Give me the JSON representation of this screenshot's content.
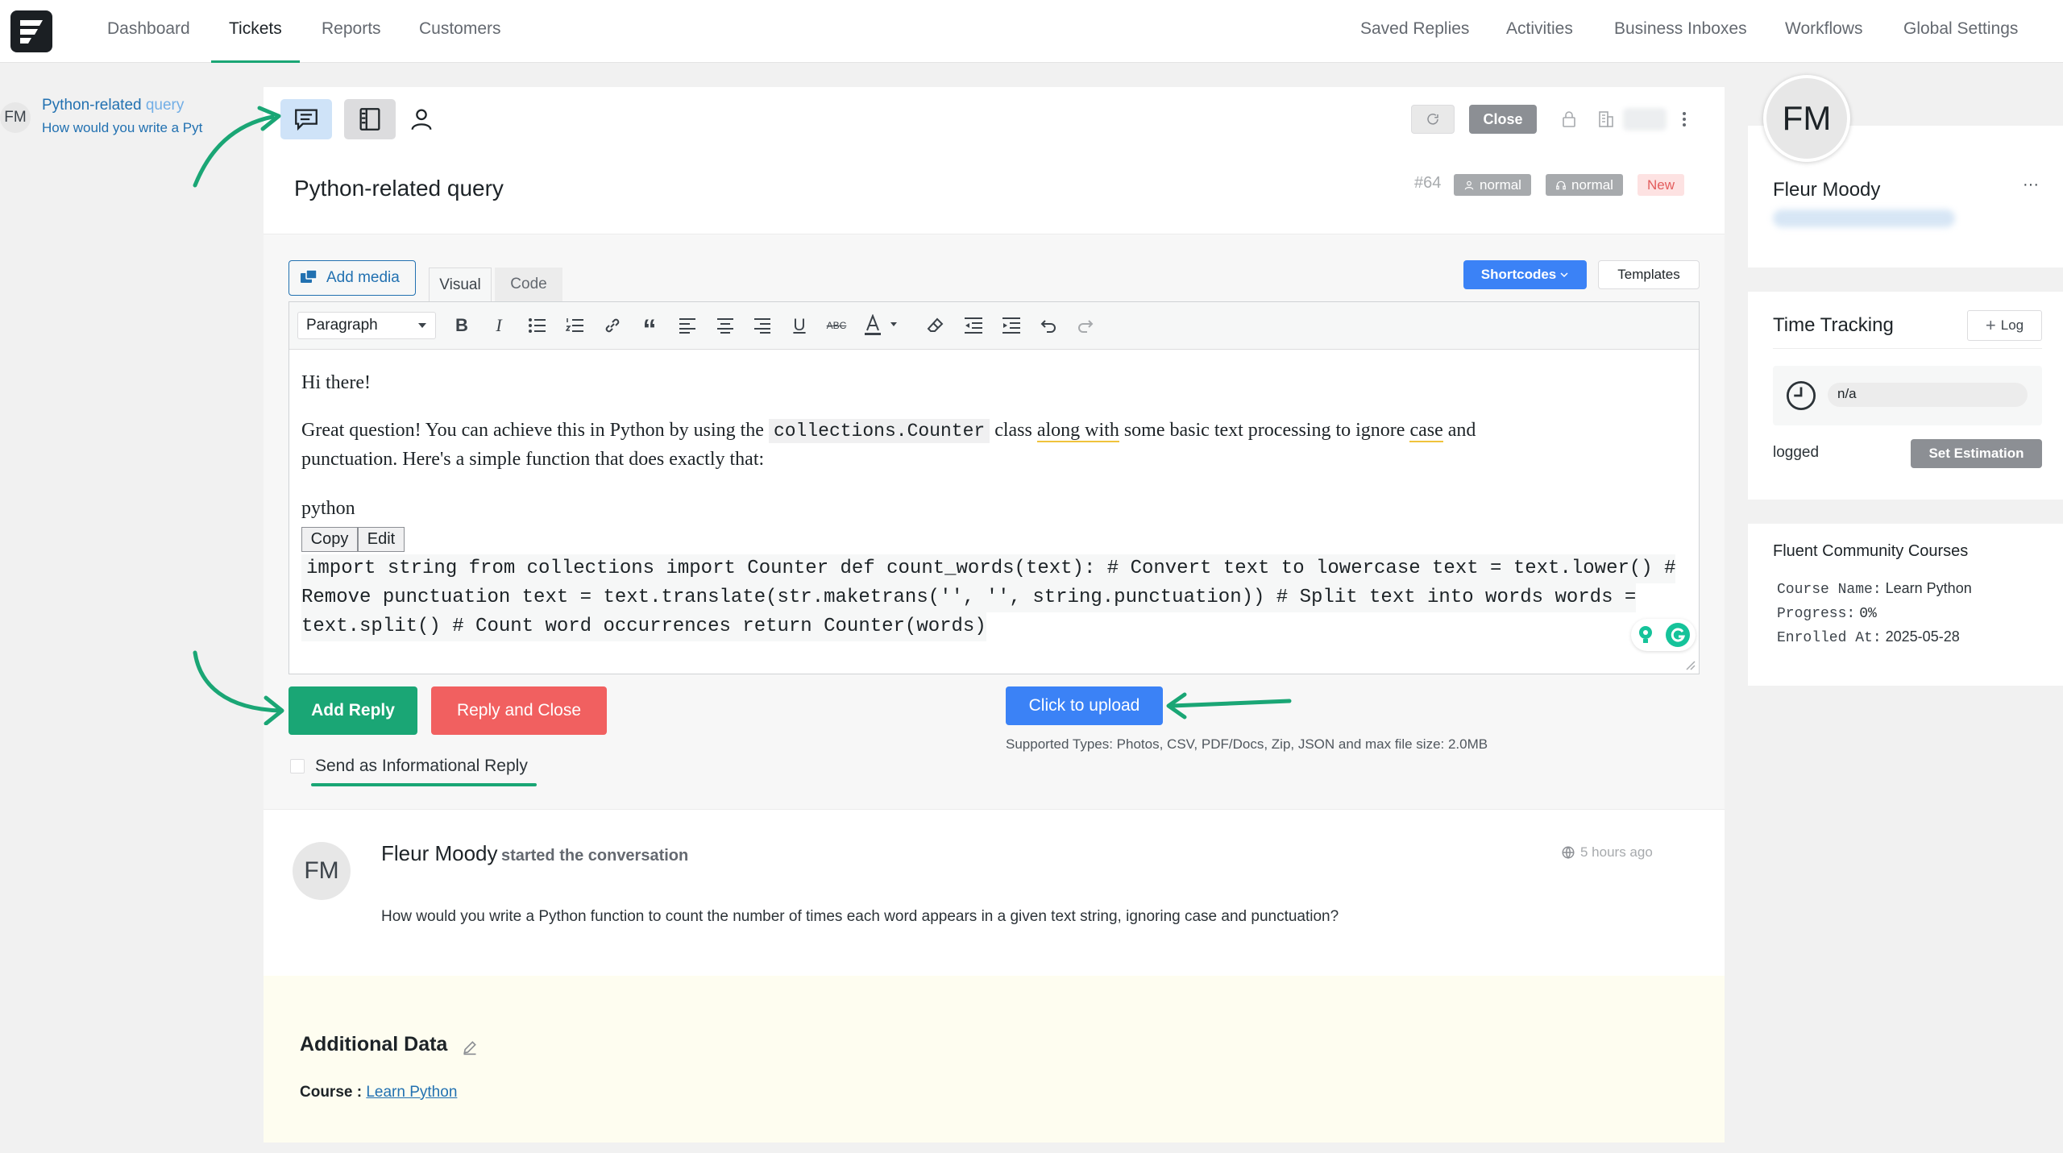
{
  "nav": {
    "left": [
      "Dashboard",
      "Tickets",
      "Reports",
      "Customers"
    ],
    "right": [
      "Saved Replies",
      "Activities",
      "Business Inboxes",
      "Workflows",
      "Global Settings"
    ]
  },
  "sidebar_ticket": {
    "avatar": "FM",
    "title": "Python-related",
    "title_tail": "query",
    "subtitle": "How would you write a Pyt"
  },
  "ticket": {
    "title": "Python-related query",
    "number": "#64",
    "badge_priority": "normal",
    "badge_client_priority": "normal",
    "badge_status": "New",
    "close_label": "Close"
  },
  "editor": {
    "add_media": "Add media",
    "tab_visual": "Visual",
    "tab_code": "Code",
    "shortcodes": "Shortcodes",
    "templates": "Templates",
    "format_select": "Paragraph",
    "greeting": "Hi there!",
    "p1_a": "Great question! You can achieve this in Python by using the ",
    "p1_code": "collections.Counter",
    "p1_b": " class ",
    "p1_u1": "along with",
    "p1_c": " some basic text processing to ignore ",
    "p1_u2": "case",
    "p1_d": " and",
    "p1_line2": "punctuation. Here's a simple function that does exactly that:",
    "lang": "python",
    "copy": "Copy",
    "edit": "Edit",
    "code_l1": "import string from collections import Counter def count_words(text): # Convert text to lowercase text = text.lower() #",
    "code_l2": "Remove punctuation text = text.translate(str.maketrans('', '', string.punctuation)) # Split text into words words =",
    "code_l3": "text.split() # Count word occurrences return Counter(words)"
  },
  "actions": {
    "add_reply": "Add Reply",
    "reply_close": "Reply and Close",
    "upload": "Click to upload",
    "supported": "Supported Types: Photos, CSV, PDF/Docs, Zip, JSON and max file size: 2.0MB",
    "informational": "Send as Informational Reply"
  },
  "conversation": {
    "avatar": "FM",
    "name": "Fleur Moody",
    "action": "started the conversation",
    "time": "5 hours ago",
    "message": "How would you write a Python function to count the number of times each word appears in a given text string, ignoring case and punctuation?"
  },
  "additional": {
    "title": "Additional Data",
    "course_label": "Course :",
    "course_link": "Learn Python"
  },
  "customer": {
    "avatar": "FM",
    "name": "Fleur Moody",
    "more": "···"
  },
  "time_tracking": {
    "title": "Time Tracking",
    "log": "Log",
    "value": "n/a",
    "logged": "logged",
    "set_estimation": "Set Estimation"
  },
  "community": {
    "title": "Fluent Community Courses",
    "course_name_label": "Course Name:",
    "course_name": "Learn Python",
    "progress_label": "Progress:",
    "progress": "0%",
    "enrolled_label": "Enrolled At:",
    "enrolled": "2025-05-28"
  },
  "colors": {
    "accent_green": "#1aa675",
    "danger": "#f16060",
    "primary_blue": "#3b82f6",
    "status_new_bg": "#fde2e2",
    "badge_gray": "#a7aaad",
    "additional_bg": "#fefdf0"
  }
}
